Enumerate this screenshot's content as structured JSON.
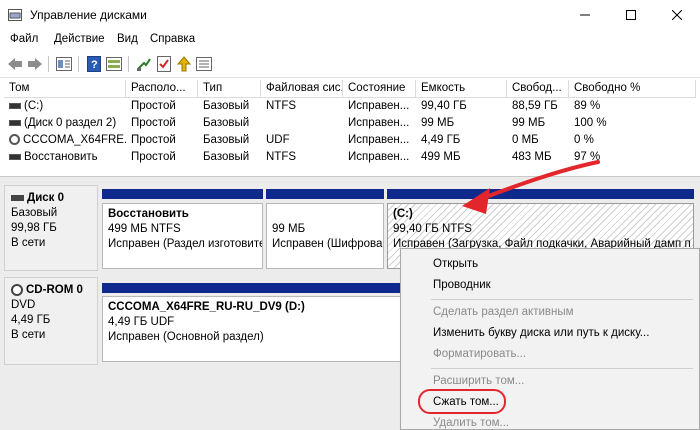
{
  "window": {
    "title": "Управление дисками"
  },
  "menu": [
    "Файл",
    "Действие",
    "Вид",
    "Справка"
  ],
  "toolbar": {
    "icons": [
      "back-icon",
      "forward-icon",
      "disk-list-icon",
      "help-icon",
      "properties-icon",
      "connect-icon",
      "check-icon",
      "up-icon",
      "settings-icon"
    ]
  },
  "volume_table": {
    "columns": [
      "Том",
      "Располо...",
      "Тип",
      "Файловая сис...",
      "Состояние",
      "Емкость",
      "Свобод...",
      "Свободно %"
    ],
    "rows": [
      [
        "(C:)",
        "Простой",
        "Базовый",
        "NTFS",
        "Исправен...",
        "99,40 ГБ",
        "88,59 ГБ",
        "89 %"
      ],
      [
        "(Диск 0 раздел 2)",
        "Простой",
        "Базовый",
        "",
        "Исправен...",
        "99 МБ",
        "99 МБ",
        "100 %"
      ],
      [
        "CCCOMA_X64FRE...",
        "Простой",
        "Базовый",
        "UDF",
        "Исправен...",
        "4,49 ГБ",
        "0 МБ",
        "0 %"
      ],
      [
        "Восстановить",
        "Простой",
        "Базовый",
        "NTFS",
        "Исправен...",
        "499 МБ",
        "483 МБ",
        "97 %"
      ]
    ]
  },
  "disks": [
    {
      "name": "Диск 0",
      "type": "Базовый",
      "size": "99,98 ГБ",
      "status": "В сети",
      "partitions": [
        {
          "title": "Восстановить",
          "size": "499 МБ NTFS",
          "status": "Исправен (Раздел изготовите"
        },
        {
          "title": "",
          "size": "99 МБ",
          "status": "Исправен (Шифрова"
        },
        {
          "title": "(C:)",
          "size": "99,40 ГБ NTFS",
          "status": "Исправен (Загрузка, Файл подкачки, Аварийный дамп п"
        }
      ]
    },
    {
      "name": "CD-ROM 0",
      "type": "DVD",
      "size": "4,49 ГБ",
      "status": "В сети",
      "partitions": [
        {
          "title": "CCCOMA_X64FRE_RU-RU_DV9  (D:)",
          "size": "4,49 ГБ UDF",
          "status": "Исправен (Основной раздел)"
        }
      ]
    }
  ],
  "context_menu": {
    "items": [
      {
        "label": "Открыть",
        "enabled": true
      },
      {
        "label": "Проводник",
        "enabled": true
      },
      {
        "label": "Сделать раздел активным",
        "enabled": false
      },
      {
        "label": "Изменить букву диска или путь к диску...",
        "enabled": true
      },
      {
        "label": "Форматировать...",
        "enabled": false
      },
      {
        "label": "Расширить том...",
        "enabled": false
      },
      {
        "label": "Сжать том...",
        "enabled": true
      },
      {
        "label": "Удалить том...",
        "enabled": false
      }
    ]
  },
  "colors": {
    "partition_bar": "#0f2a8c",
    "annotation_red": "#e3262c"
  }
}
